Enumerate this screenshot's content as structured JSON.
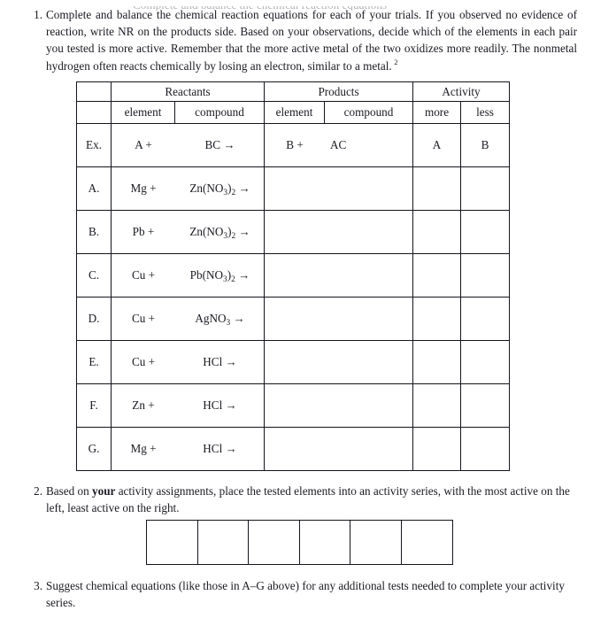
{
  "document": {
    "clipped_line_above": "Complete and balance the chemical reaction equations"
  },
  "questions": {
    "q1": {
      "number": "1.",
      "text_part1": "Complete and balance the chemical reaction equations for each of your trials. If you observed no evidence of reaction, write NR on the products side. Based on your observations, decide which of the elements in each pair you tested is more active. Remember that the more active metal of the two oxidizes more readily. The nonmetal hydrogen often reacts chemically by losing an electron, similar to a metal.",
      "footnote_marker": "2"
    },
    "q2": {
      "number": "2.",
      "text_before_bold": "Based on ",
      "bold_word": "your",
      "text_after_bold": " activity assignments, place the tested elements into an activity series, with the most active on the left, least active on the right."
    },
    "q3": {
      "number": "3.",
      "text": "Suggest chemical equations (like those in A–G above) for any additional tests needed to complete your activity series."
    }
  },
  "reaction_table": {
    "group_headers": {
      "blank": "",
      "reactants": "Reactants",
      "products": "Products",
      "activity": "Activity"
    },
    "sub_headers": {
      "blank": "",
      "reactant_element": "element",
      "reactant_compound": "compound",
      "product_element": "element",
      "product_compound": "compound",
      "more": "more",
      "less": "less"
    },
    "rows": [
      {
        "label": "Ex.",
        "reactant_element": "A +",
        "reactant_compound": "BC →",
        "product_element": "B +",
        "product_compound": "AC",
        "more": "A",
        "less": "B"
      },
      {
        "label": "A.",
        "reactant_element": "Mg +",
        "reactant_compound_html": "Zn(NO<sub>3</sub>)<sub>2</sub> →",
        "product_element": "",
        "product_compound": "",
        "more": "",
        "less": ""
      },
      {
        "label": "B.",
        "reactant_element": "Pb +",
        "reactant_compound_html": "Zn(NO<sub>3</sub>)<sub>2</sub> →",
        "product_element": "",
        "product_compound": "",
        "more": "",
        "less": ""
      },
      {
        "label": "C.",
        "reactant_element": "Cu +",
        "reactant_compound_html": "Pb(NO<sub>3</sub>)<sub>2</sub> →",
        "product_element": "",
        "product_compound": "",
        "more": "",
        "less": ""
      },
      {
        "label": "D.",
        "reactant_element": "Cu +",
        "reactant_compound_html": "AgNO<sub>3</sub> →",
        "product_element": "",
        "product_compound": "",
        "more": "",
        "less": ""
      },
      {
        "label": "E.",
        "reactant_element": "Cu +",
        "reactant_compound_html": "HCl →",
        "product_element": "",
        "product_compound": "",
        "more": "",
        "less": ""
      },
      {
        "label": "F.",
        "reactant_element": "Zn +",
        "reactant_compound_html": "HCl →",
        "product_element": "",
        "product_compound": "",
        "more": "",
        "less": ""
      },
      {
        "label": "G.",
        "reactant_element": "Mg +",
        "reactant_compound_html": "HCl →",
        "product_element": "",
        "product_compound": "",
        "more": "",
        "less": ""
      }
    ]
  },
  "activity_series_boxes": {
    "count": 6,
    "values": [
      "",
      "",
      "",
      "",
      "",
      ""
    ]
  },
  "colors": {
    "text": "#1a1a22",
    "border": "#14141c",
    "background": "#ffffff"
  }
}
